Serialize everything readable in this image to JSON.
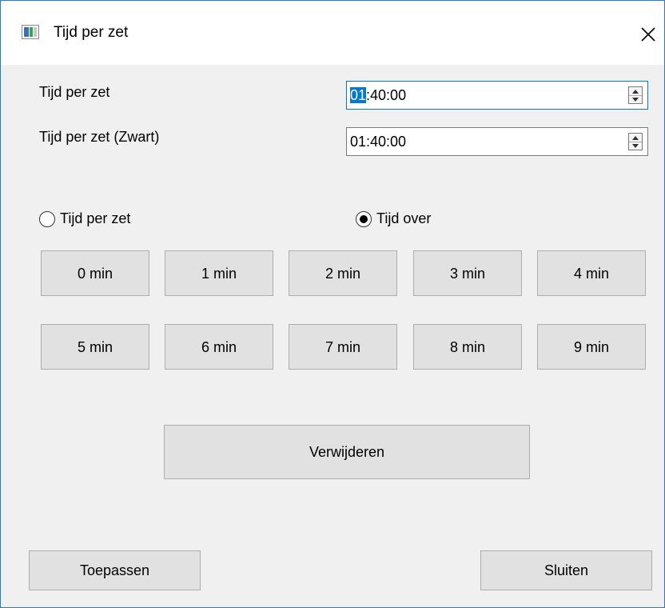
{
  "window": {
    "title": "Tijd per zet"
  },
  "fields": [
    {
      "label": "Tijd per zet",
      "value_selected": "01",
      "value_rest": ":40:00"
    },
    {
      "label": "Tijd per zet (Zwart)",
      "value": "01:40:00"
    }
  ],
  "radios": [
    {
      "label": "Tijd per zet",
      "checked": false
    },
    {
      "label": "Tijd over",
      "checked": true
    }
  ],
  "minute_buttons": [
    "0 min",
    "1 min",
    "2 min",
    "3 min",
    "4 min",
    "5 min",
    "6 min",
    "7 min",
    "8 min",
    "9 min"
  ],
  "actions": {
    "remove": "Verwijderen",
    "apply": "Toepassen",
    "close": "Sluiten"
  },
  "colors": {
    "accent": "#0078d7",
    "window_border": "#2b79d7",
    "button_bg": "#e1e1e1"
  }
}
